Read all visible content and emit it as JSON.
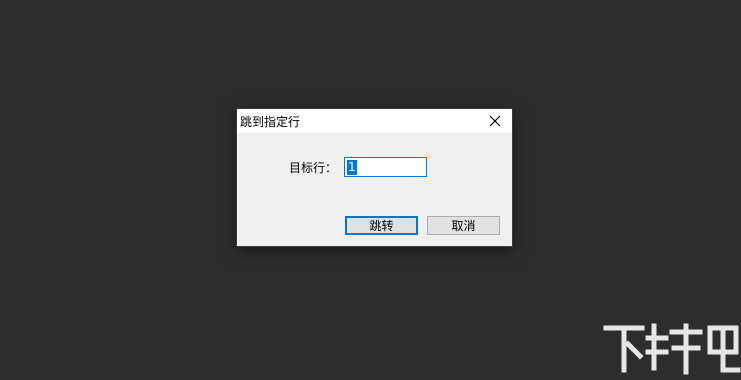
{
  "dialog": {
    "title": "跳到指定行",
    "close_icon": "close-icon",
    "field_label": "目标行：",
    "field_value": "1",
    "buttons": {
      "go_label": "跳转",
      "cancel_label": "取消"
    }
  },
  "colors": {
    "background": "#2d2d2d",
    "dialog_body": "#f0f0f0",
    "accent": "#0078d7"
  },
  "watermark": {
    "logo_text": "下载吧"
  }
}
